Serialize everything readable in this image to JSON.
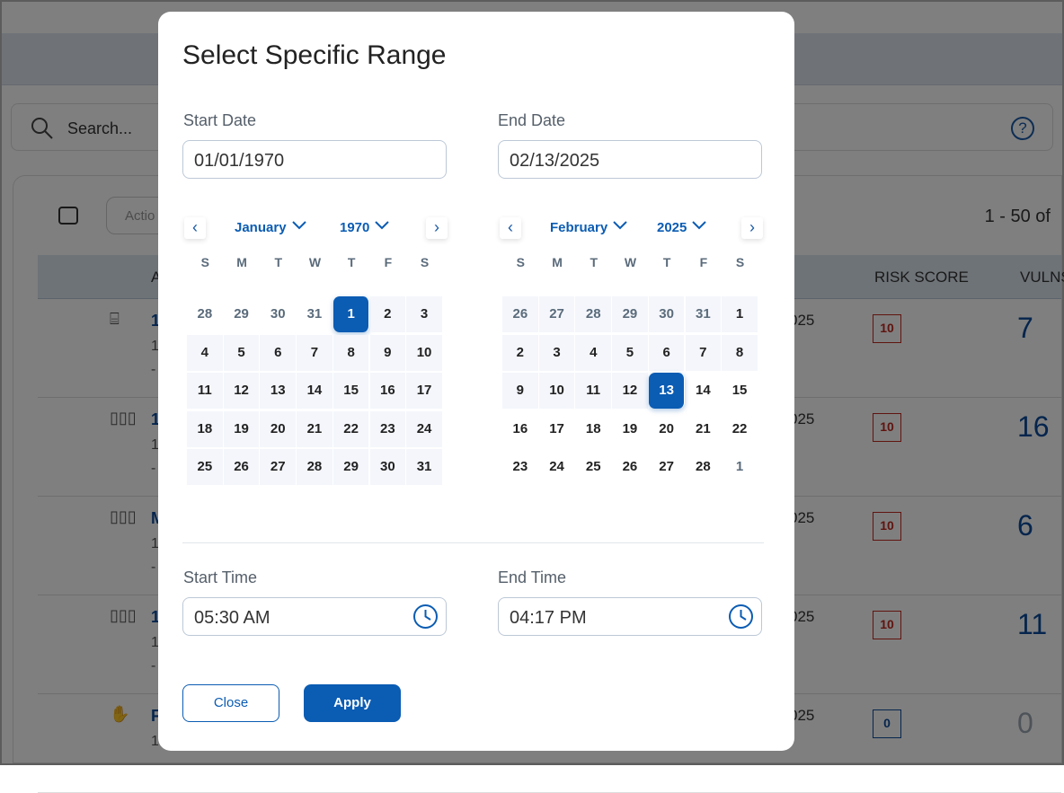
{
  "background": {
    "search_placeholder": "Search...",
    "actions_label": "Actio",
    "count_label": "1 - 50 of",
    "columns": {
      "asset": "A",
      "risk_score": "RISK SCORE",
      "vulns": "VULNS"
    },
    "rows": [
      {
        "icon": "network-port-icon",
        "name": "1",
        "date": "025",
        "risk": "10",
        "vulns": "7",
        "sub": "1",
        "dash": "-"
      },
      {
        "icon": "server-rack-icon",
        "name": "1",
        "date": "025",
        "risk": "10",
        "vulns": "16",
        "sub": "1",
        "dash": "-"
      },
      {
        "icon": "server-rack-icon",
        "name": "M",
        "date": "025",
        "risk": "10",
        "vulns": "6",
        "sub": "1",
        "dash": "-"
      },
      {
        "icon": "server-rack-icon",
        "name": "1",
        "date": "025",
        "risk": "10",
        "vulns": "11",
        "sub": "1",
        "dash": "-"
      },
      {
        "icon": "hand-icon",
        "name": "F",
        "date": "025",
        "risk": "0",
        "vulns": "0",
        "sub": "1",
        "dash": ""
      }
    ]
  },
  "modal": {
    "title": "Select Specific Range",
    "start_date_label": "Start Date",
    "start_date_value": "01/01/1970",
    "end_date_label": "End Date",
    "end_date_value": "02/13/2025",
    "start_time_label": "Start Time",
    "start_time_value": "05:30 AM",
    "end_time_label": "End Time",
    "end_time_value": "04:17 PM",
    "close_label": "Close",
    "apply_label": "Apply",
    "weekdays": [
      "S",
      "M",
      "T",
      "W",
      "T",
      "F",
      "S"
    ],
    "calendars": [
      {
        "month": "January",
        "year": "1970",
        "weeks": [
          [
            {
              "d": 28,
              "m": 1
            },
            {
              "d": 29,
              "m": 1
            },
            {
              "d": 30,
              "m": 1
            },
            {
              "d": 31,
              "m": 1
            },
            {
              "d": 1,
              "s": 1
            },
            {
              "d": 2,
              "r": 1
            },
            {
              "d": 3,
              "r": 1
            }
          ],
          [
            {
              "d": 4,
              "r": 1
            },
            {
              "d": 5,
              "r": 1
            },
            {
              "d": 6,
              "r": 1
            },
            {
              "d": 7,
              "r": 1
            },
            {
              "d": 8,
              "r": 1
            },
            {
              "d": 9,
              "r": 1
            },
            {
              "d": 10,
              "r": 1
            }
          ],
          [
            {
              "d": 11,
              "r": 1
            },
            {
              "d": 12,
              "r": 1
            },
            {
              "d": 13,
              "r": 1
            },
            {
              "d": 14,
              "r": 1
            },
            {
              "d": 15,
              "r": 1
            },
            {
              "d": 16,
              "r": 1
            },
            {
              "d": 17,
              "r": 1
            }
          ],
          [
            {
              "d": 18,
              "r": 1
            },
            {
              "d": 19,
              "r": 1
            },
            {
              "d": 20,
              "r": 1
            },
            {
              "d": 21,
              "r": 1
            },
            {
              "d": 22,
              "r": 1
            },
            {
              "d": 23,
              "r": 1
            },
            {
              "d": 24,
              "r": 1
            }
          ],
          [
            {
              "d": 25,
              "r": 1
            },
            {
              "d": 26,
              "r": 1
            },
            {
              "d": 27,
              "r": 1
            },
            {
              "d": 28,
              "r": 1
            },
            {
              "d": 29,
              "r": 1
            },
            {
              "d": 30,
              "r": 1
            },
            {
              "d": 31,
              "r": 1
            }
          ]
        ]
      },
      {
        "month": "February",
        "year": "2025",
        "weeks": [
          [
            {
              "d": 26,
              "m": 1,
              "r": 1
            },
            {
              "d": 27,
              "m": 1,
              "r": 1
            },
            {
              "d": 28,
              "m": 1,
              "r": 1
            },
            {
              "d": 29,
              "m": 1,
              "r": 1
            },
            {
              "d": 30,
              "m": 1,
              "r": 1
            },
            {
              "d": 31,
              "m": 1,
              "r": 1
            },
            {
              "d": 1,
              "r": 1
            }
          ],
          [
            {
              "d": 2,
              "r": 1
            },
            {
              "d": 3,
              "r": 1
            },
            {
              "d": 4,
              "r": 1
            },
            {
              "d": 5,
              "r": 1
            },
            {
              "d": 6,
              "r": 1
            },
            {
              "d": 7,
              "r": 1
            },
            {
              "d": 8,
              "r": 1
            }
          ],
          [
            {
              "d": 9,
              "r": 1
            },
            {
              "d": 10,
              "r": 1
            },
            {
              "d": 11,
              "r": 1
            },
            {
              "d": 12,
              "r": 1
            },
            {
              "d": 13,
              "s": 1
            },
            {
              "d": 14
            },
            {
              "d": 15
            }
          ],
          [
            {
              "d": 16
            },
            {
              "d": 17
            },
            {
              "d": 18
            },
            {
              "d": 19
            },
            {
              "d": 20
            },
            {
              "d": 21
            },
            {
              "d": 22
            }
          ],
          [
            {
              "d": 23
            },
            {
              "d": 24
            },
            {
              "d": 25
            },
            {
              "d": 26
            },
            {
              "d": 27
            },
            {
              "d": 28
            },
            {
              "d": 1,
              "m": 1
            }
          ]
        ]
      }
    ]
  },
  "colors": {
    "accent": "#0b5cb3",
    "range_bg": "#f4f6fb",
    "risk_high": "#c0281f"
  }
}
